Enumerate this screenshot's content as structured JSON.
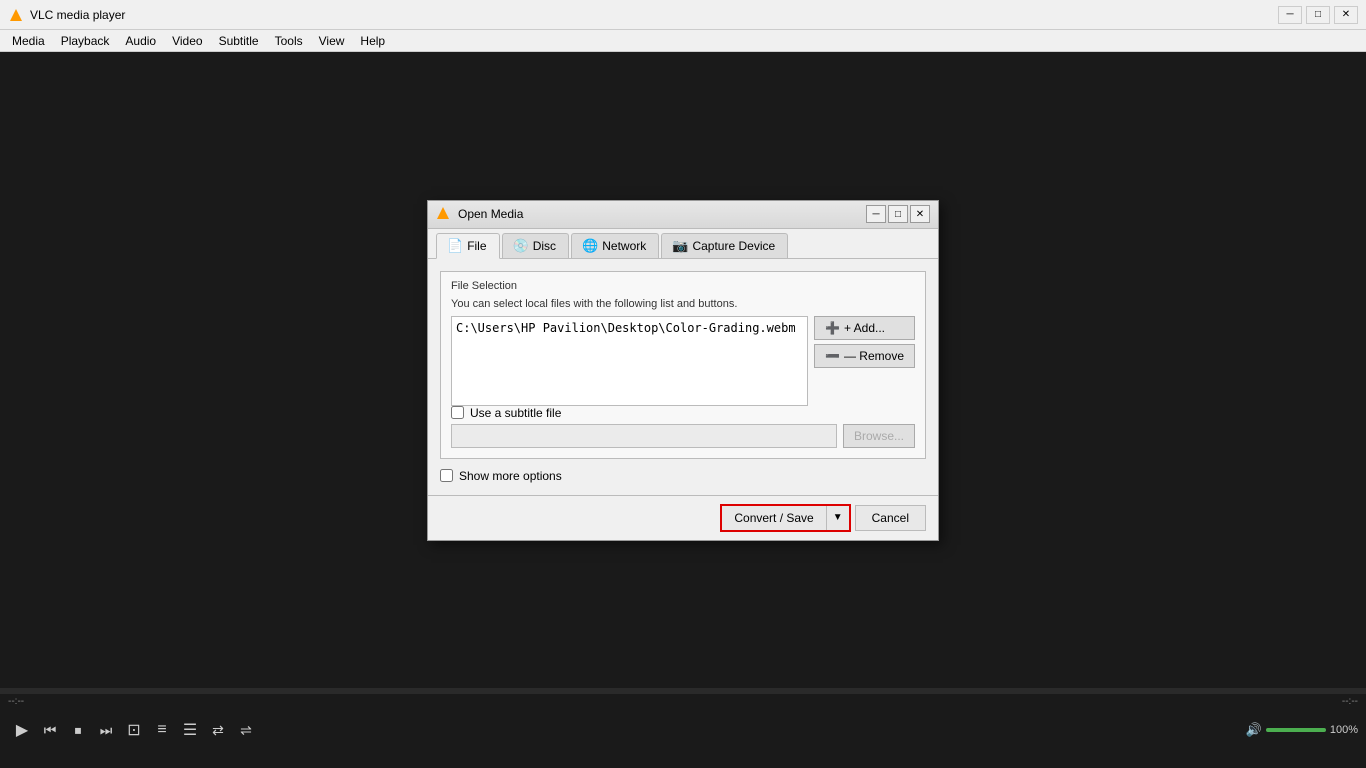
{
  "app": {
    "title": "VLC media player",
    "icon": "vlc-icon"
  },
  "titlebar": {
    "minimize_label": "─",
    "maximize_label": "□",
    "close_label": "✕"
  },
  "menubar": {
    "items": [
      {
        "label": "Media"
      },
      {
        "label": "Playback"
      },
      {
        "label": "Audio"
      },
      {
        "label": "Video"
      },
      {
        "label": "Subtitle"
      },
      {
        "label": "Tools"
      },
      {
        "label": "View"
      },
      {
        "label": "Help"
      }
    ]
  },
  "dialog": {
    "title": "Open Media",
    "minimize_label": "─",
    "maximize_label": "□",
    "close_label": "✕",
    "tabs": [
      {
        "label": "File",
        "icon": "📄",
        "active": true
      },
      {
        "label": "Disc",
        "icon": "💿",
        "active": false
      },
      {
        "label": "Network",
        "icon": "🌐",
        "active": false
      },
      {
        "label": "Capture Device",
        "icon": "📷",
        "active": false
      }
    ],
    "file_selection": {
      "group_label": "File Selection",
      "description": "You can select local files with the following list and buttons.",
      "file_path": "C:\\Users\\HP Pavilion\\Desktop\\Color-Grading.webm",
      "add_button": "+ Add...",
      "remove_button": "— Remove",
      "subtitle_checkbox_label": "Use a subtitle file",
      "subtitle_checked": false,
      "subtitle_path_placeholder": "",
      "browse_button": "Browse..."
    },
    "show_more_label": "Show more options",
    "show_more_checked": false,
    "convert_save_label": "Convert / Save",
    "convert_save_arrow": "▼",
    "cancel_label": "Cancel"
  },
  "controls": {
    "time_left": "--:--",
    "time_right": "--:--",
    "play_btn": "▶",
    "skip_back_btn": "⏮",
    "stop_btn": "⏹",
    "skip_fwd_btn": "⏭",
    "frame_btn": "⊡",
    "eq_btn": "≡",
    "playlist_btn": "☰",
    "loop_btn": "🔁",
    "shuffle_btn": "🔀",
    "volume_label": "🔊",
    "volume_pct": "100%",
    "volume_fill": 100
  }
}
